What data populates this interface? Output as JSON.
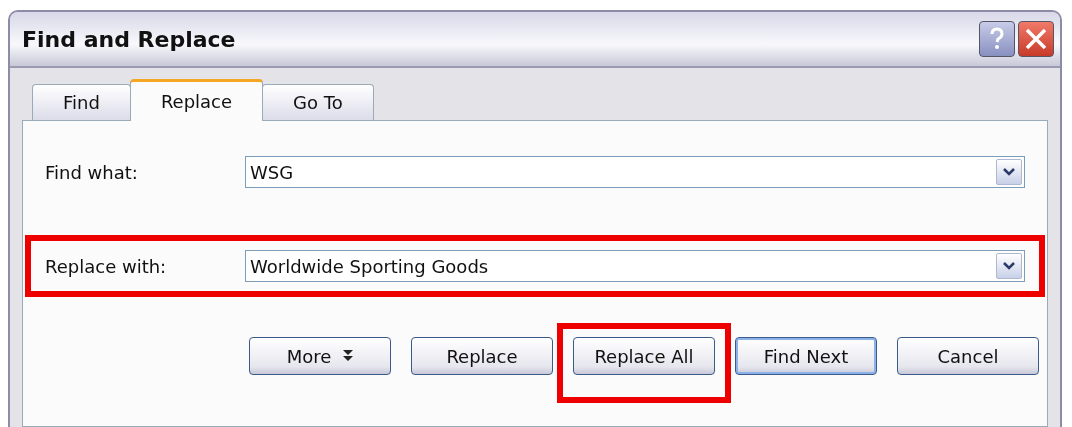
{
  "window": {
    "title": "Find and Replace"
  },
  "tabs": [
    {
      "label": "Find",
      "selected": false
    },
    {
      "label": "Replace",
      "selected": true
    },
    {
      "label": "Go To",
      "selected": false
    }
  ],
  "fields": [
    {
      "label": "Find what:",
      "value": "WSG",
      "highlighted": false
    },
    {
      "label": "Replace with:",
      "value": "Worldwide Sporting Goods",
      "highlighted": true
    }
  ],
  "buttons": [
    {
      "label": "More",
      "kind": "more",
      "default": false,
      "highlighted": false
    },
    {
      "label": "Replace",
      "kind": "plain",
      "default": false,
      "highlighted": false
    },
    {
      "label": "Replace All",
      "kind": "plain",
      "default": false,
      "highlighted": true
    },
    {
      "label": "Find Next",
      "kind": "plain",
      "default": true,
      "highlighted": false
    },
    {
      "label": "Cancel",
      "kind": "plain",
      "default": false,
      "highlighted": false
    }
  ]
}
